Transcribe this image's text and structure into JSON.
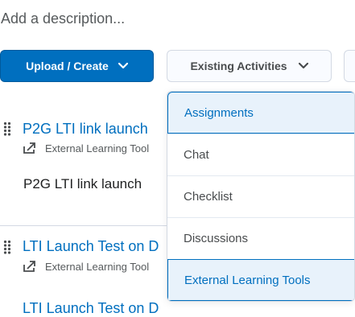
{
  "description_placeholder": "Add a description...",
  "toolbar": {
    "upload_label": "Upload / Create",
    "existing_label": "Existing Activities"
  },
  "items": [
    {
      "title": "P2G LTI link launch",
      "type": "External Learning Tool",
      "description": "P2G LTI link launch"
    },
    {
      "title": "LTI Launch Test on D",
      "type": "External Learning Tool"
    },
    {
      "title": "LTI Launch Test on D"
    }
  ],
  "dropdown": {
    "options": [
      {
        "label": "Assignments",
        "highlighted": true
      },
      {
        "label": "Chat",
        "highlighted": false
      },
      {
        "label": "Checklist",
        "highlighted": false
      },
      {
        "label": "Discussions",
        "highlighted": false
      },
      {
        "label": "External Learning Tools",
        "highlighted": true
      }
    ]
  },
  "colors": {
    "primary": "#006fbf",
    "highlight_bg": "#e8f2fb",
    "border": "#d3d9e3"
  }
}
